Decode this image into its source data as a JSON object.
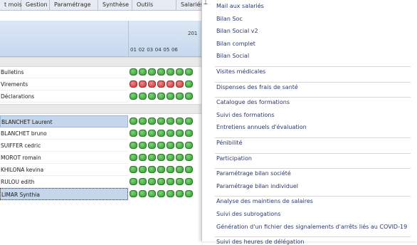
{
  "tabs": [
    "t mois",
    "Gestion",
    "Paramétrage",
    "Synthèse",
    "Outils",
    "Salariés"
  ],
  "grid": {
    "year": "201",
    "months": [
      "01",
      "02",
      "03",
      "04",
      "05",
      "06"
    ],
    "summary_rows": [
      {
        "label": "Bulletins",
        "dots": [
          "g",
          "g",
          "g",
          "g",
          "g",
          "g",
          "g"
        ]
      },
      {
        "label": "Virements",
        "dots": [
          "r",
          "r",
          "r",
          "r",
          "r",
          "r",
          "g"
        ]
      },
      {
        "label": "Déclarations",
        "dots": [
          "g",
          "g",
          "g",
          "g",
          "g",
          "g",
          "g"
        ]
      }
    ],
    "employee_rows": [
      {
        "label": "BLANCHET Laurent",
        "dots": [
          "g",
          "g",
          "g",
          "g",
          "g",
          "g",
          "g"
        ],
        "state": "hl"
      },
      {
        "label": "BLANCHET bruno",
        "dots": [
          "g",
          "g",
          "g",
          "g",
          "g",
          "g",
          "g"
        ],
        "state": ""
      },
      {
        "label": "SUIFFER cedric",
        "dots": [
          "g",
          "g",
          "g",
          "g",
          "g",
          "g",
          "g"
        ],
        "state": ""
      },
      {
        "label": "MOROT romain",
        "dots": [
          "g",
          "g",
          "g",
          "g",
          "g",
          "g",
          "g"
        ],
        "state": ""
      },
      {
        "label": "KHILONA kevina",
        "dots": [
          "g",
          "g",
          "g",
          "g",
          "g",
          "g",
          "g"
        ],
        "state": ""
      },
      {
        "label": "RULOU edith",
        "dots": [
          "g",
          "g",
          "g",
          "g",
          "g",
          "g",
          "g"
        ],
        "state": ""
      },
      {
        "label": "LIMAR Synthia",
        "dots": [
          "g",
          "g",
          "g",
          "g",
          "g",
          "g",
          "g"
        ],
        "state": "sel"
      }
    ]
  },
  "menu": {
    "groups": [
      [
        "Mail aux salariés",
        "Bilan Soc",
        "Bilan Social v2",
        "Bilan complet",
        "Bilan Social"
      ],
      [
        "Visites médicales"
      ],
      [
        "Dispenses des frais de santé"
      ],
      [
        "Catalogue des formations",
        "Suivi des formations",
        "Entretiens annuels d'évaluation"
      ],
      [
        "Pénibilité"
      ],
      [
        "Participation"
      ],
      [
        "Paramétrage bilan société",
        "Paramétrage bilan individuel"
      ],
      [
        "Analyse des maintiens de salaires",
        "Suivi des subrogations",
        "Génération d'un fichier des signalements d'arrêts liés au COVID-19"
      ],
      [
        "Suivi des heures de délégation"
      ]
    ]
  },
  "colors": {
    "green": "#2f9a2c",
    "red": "#c93636",
    "highlight": "#c5d6eb",
    "menu_text": "#2b3a6b"
  }
}
